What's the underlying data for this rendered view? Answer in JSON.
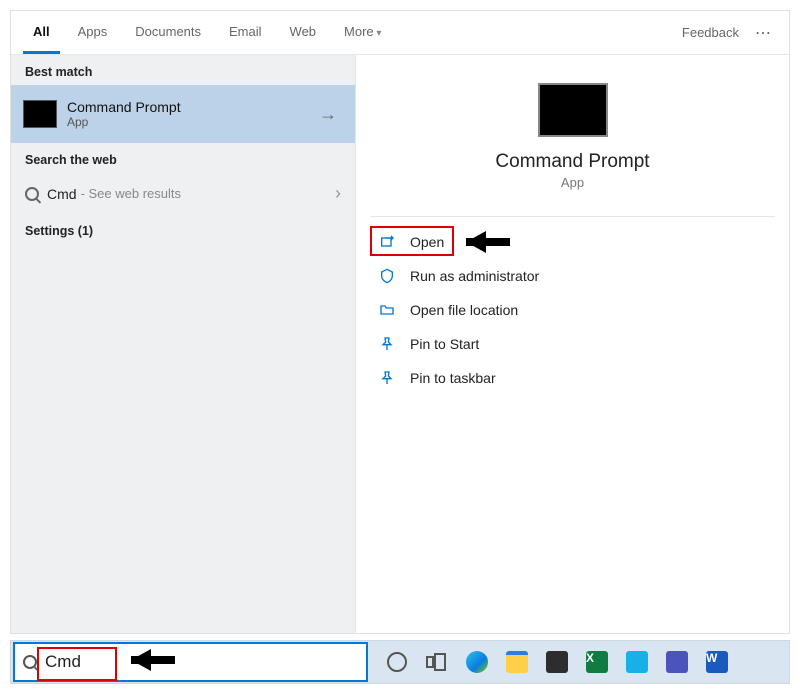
{
  "tabs": {
    "all": "All",
    "apps": "Apps",
    "documents": "Documents",
    "email": "Email",
    "web": "Web",
    "more": "More"
  },
  "header": {
    "feedback": "Feedback"
  },
  "left": {
    "best_match_label": "Best match",
    "best_match": {
      "title": "Command Prompt",
      "subtitle": "App"
    },
    "search_web_label": "Search the web",
    "web_query": "Cmd",
    "web_hint": "- See web results",
    "settings_label": "Settings (1)"
  },
  "right": {
    "title": "Command Prompt",
    "subtitle": "App",
    "actions": {
      "open": "Open",
      "run_admin": "Run as administrator",
      "open_location": "Open file location",
      "pin_start": "Pin to Start",
      "pin_taskbar": "Pin to taskbar"
    }
  },
  "search": {
    "value": "Cmd"
  }
}
